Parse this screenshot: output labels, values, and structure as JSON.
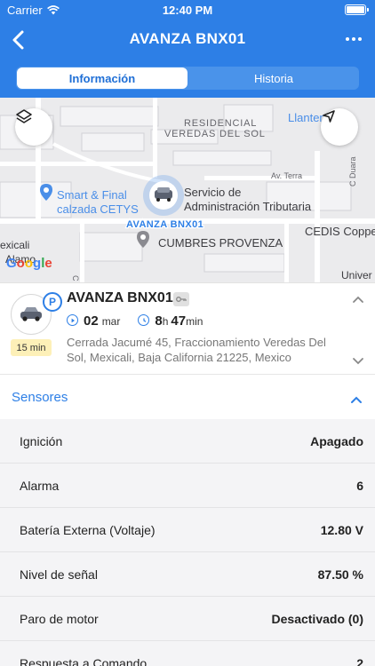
{
  "status_bar": {
    "carrier": "Carrier",
    "time": "12:40 PM"
  },
  "header": {
    "title": "AVANZA BNX01",
    "back_icon": "chevron-left-icon",
    "more_icon": "more-dots-icon"
  },
  "tabs": [
    {
      "label": "Información",
      "active": true
    },
    {
      "label": "Historia",
      "active": false
    }
  ],
  "map": {
    "labels": {
      "residencial": "RESIDENCIAL",
      "veredas": "VEREDAS DEL SOL",
      "llantera": "Llanter",
      "av_terra": "Av. Terra",
      "c_duara": "C Duara",
      "smart_final_1": "Smart & Final",
      "smart_final_2": "calzada CETYS",
      "servicio_1": "Servicio de",
      "servicio_2": "Administración Tributaria",
      "vehicle_label": "AVANZA BNX01",
      "cedis": "CEDIS Coppel",
      "cumbres": "CUMBRES PROVENZA",
      "mexicali": "exicali",
      "alamo": "Alamo",
      "c_cedi": "C Cedi",
      "univer": "Univer"
    },
    "google": "Google"
  },
  "vehicle": {
    "name": "AVANZA BNX01",
    "badge": "P",
    "minutes": "15 min",
    "day": "02",
    "month": "mar",
    "hours": "8",
    "hours_unit": "h",
    "mins": "47",
    "mins_unit": "min",
    "address": "Cerrada Jacumé 45, Fraccionamiento Veredas Del Sol, Mexicali, Baja California 21225, Mexico"
  },
  "sensors": {
    "title": "Sensores",
    "rows": [
      {
        "label": "Ignición",
        "value": "Apagado"
      },
      {
        "label": "Alarma",
        "value": "6"
      },
      {
        "label": "Batería Externa (Voltaje)",
        "value": "12.80 V"
      },
      {
        "label": "Nivel de señal",
        "value": "87.50 %"
      },
      {
        "label": "Paro de motor",
        "value": "Desactivado (0)"
      },
      {
        "label": "Respuesta a Comando",
        "value": "2"
      }
    ]
  },
  "colors": {
    "accent": "#2d7fe6",
    "minutes_badge": "#fdf0b8",
    "list_bg": "#f4f4f6"
  }
}
